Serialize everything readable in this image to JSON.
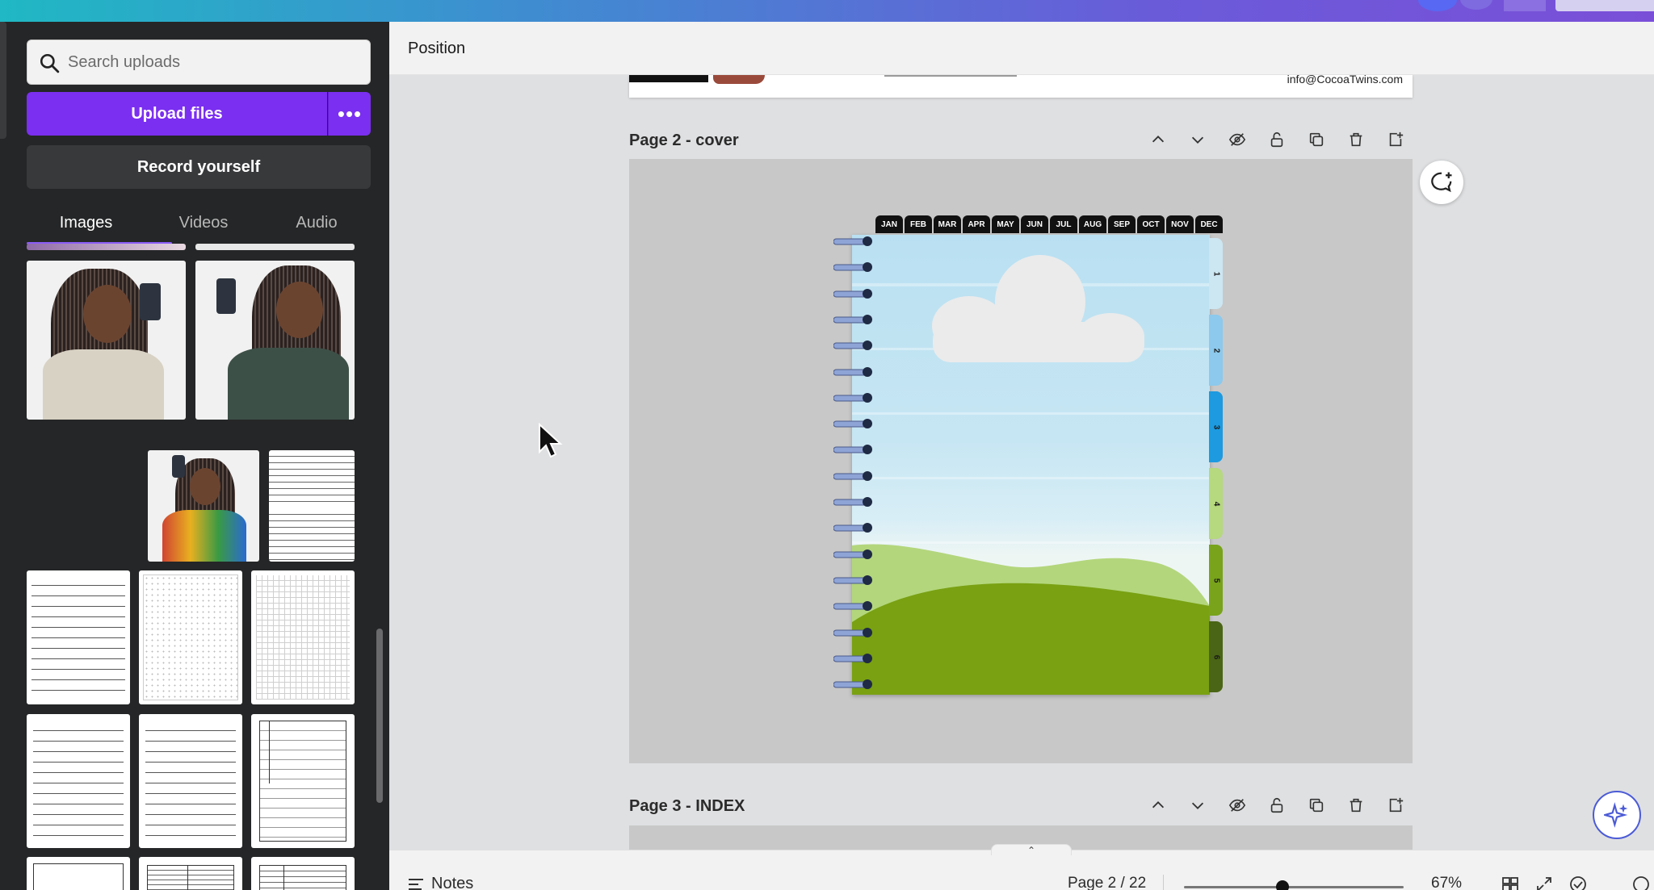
{
  "panel": {
    "search_placeholder": "Search uploads",
    "upload_label": "Upload files",
    "upload_more_label": "•••",
    "record_label": "Record yourself",
    "tabs": [
      {
        "label": "Images"
      },
      {
        "label": "Videos"
      },
      {
        "label": "Audio"
      }
    ],
    "active_tab": "Images",
    "accent_color": "#7b2ff0"
  },
  "header": {
    "position_label": "Position"
  },
  "canvas": {
    "page1_email": "info@CocoaTwins.com",
    "page2_title": "Page 2 - cover",
    "page3_title": "Page 3 - INDEX",
    "months": [
      "JAN",
      "FEB",
      "MAR",
      "APR",
      "MAY",
      "JUN",
      "JUL",
      "AUG",
      "SEP",
      "OCT",
      "NOV",
      "DEC"
    ],
    "side_tabs": [
      {
        "label": "1",
        "color": "#cce6f2"
      },
      {
        "label": "2",
        "color": "#8cc9ec"
      },
      {
        "label": "3",
        "color": "#1d9ae0"
      },
      {
        "label": "4",
        "color": "#b6d87e"
      },
      {
        "label": "5",
        "color": "#78a31b"
      },
      {
        "label": "6",
        "color": "#4a6515"
      }
    ],
    "page_controls": [
      "move-up",
      "move-down",
      "hide",
      "lock",
      "duplicate",
      "delete",
      "add-page"
    ]
  },
  "footer": {
    "notes_label": "Notes",
    "page_info": "Page 2 / 22",
    "zoom_label": "67%",
    "zoom_fraction": 0.45
  }
}
